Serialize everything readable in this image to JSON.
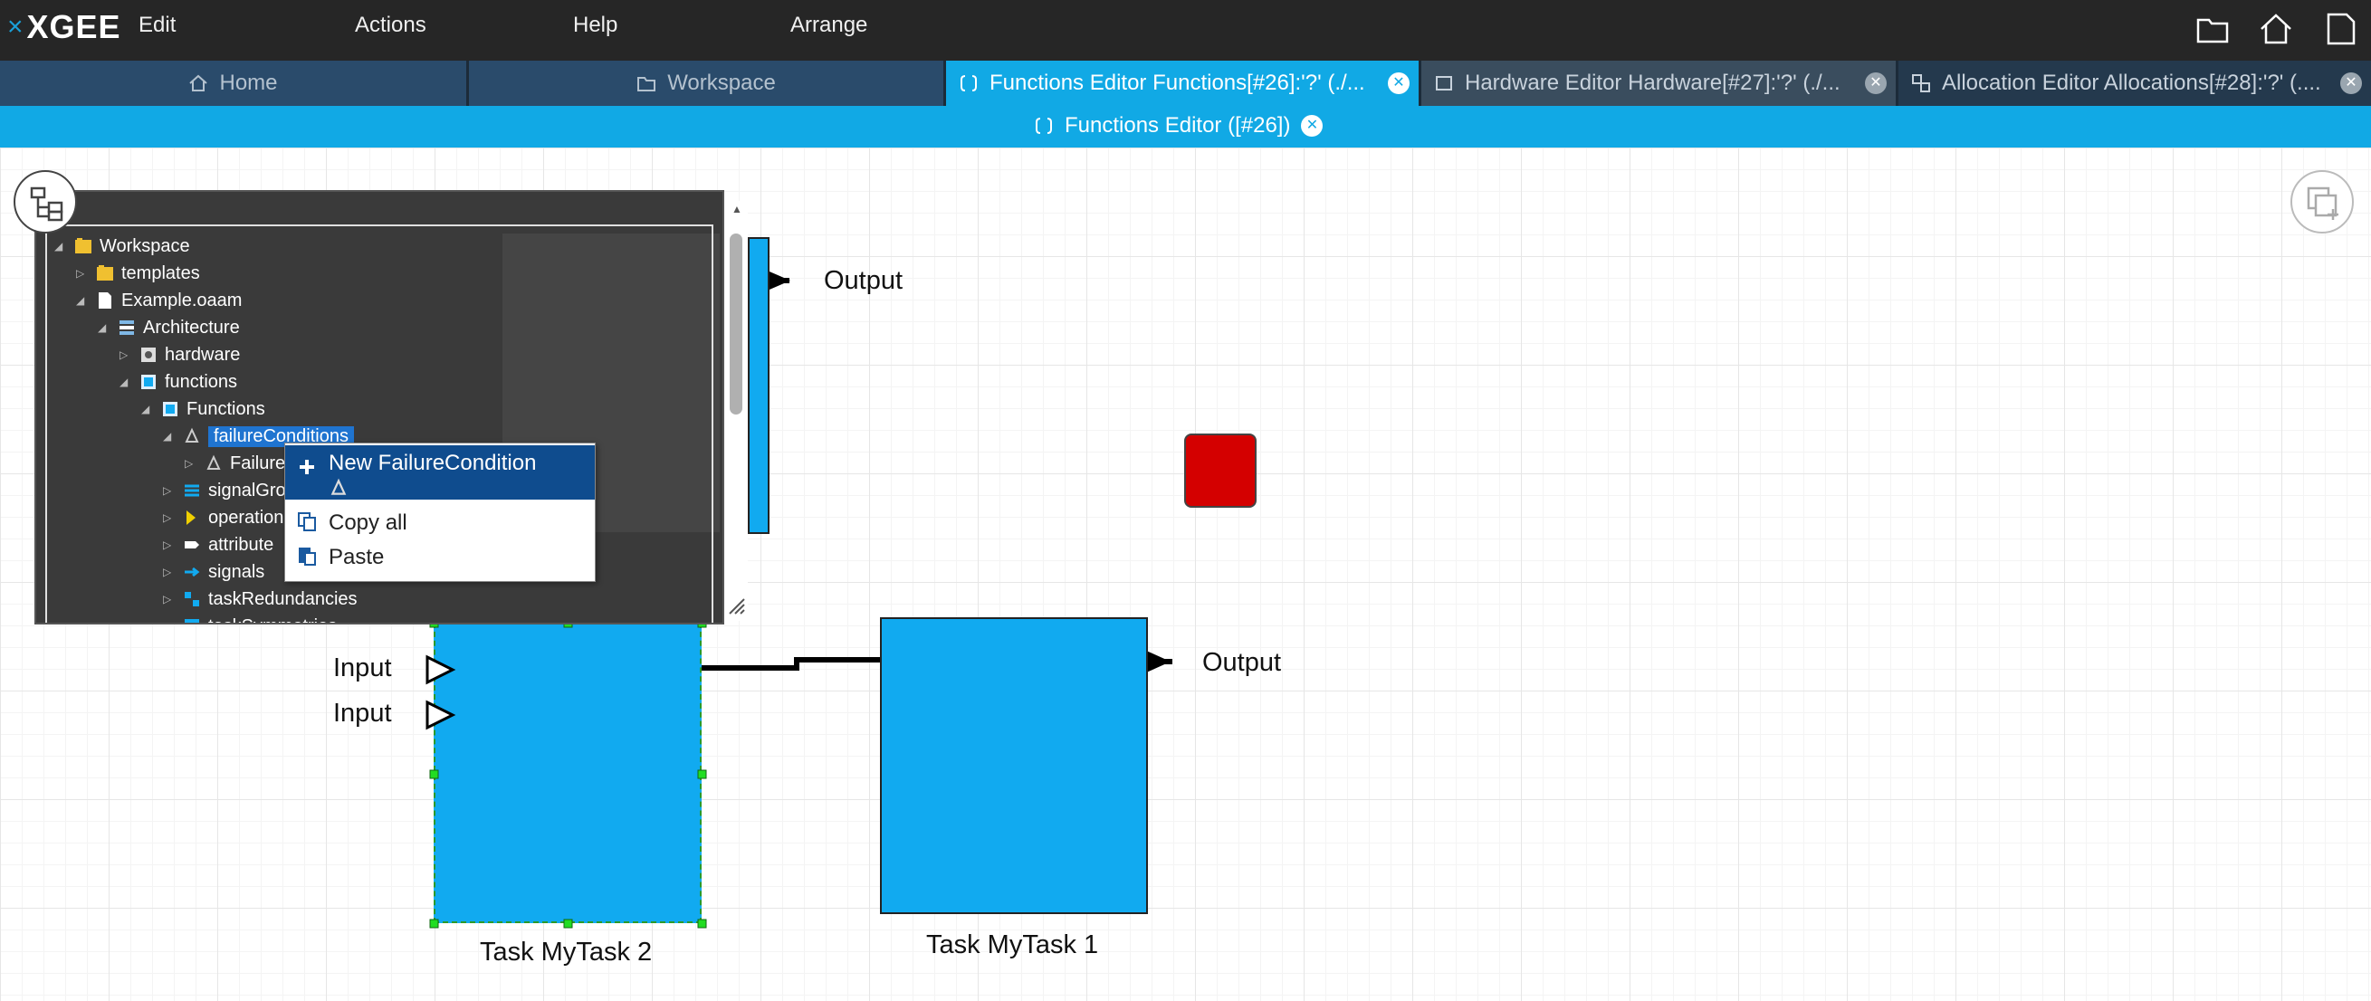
{
  "app": {
    "logo": "XGEE"
  },
  "menu": {
    "edit": "Edit",
    "actions": "Actions",
    "help": "Help",
    "arrange": "Arrange"
  },
  "tabs": [
    {
      "label": "Home",
      "icon": "home-icon",
      "active": false
    },
    {
      "label": "Workspace",
      "icon": "folder-icon",
      "active": false
    },
    {
      "label": "Functions Editor Functions[#26]:'?' (./...",
      "icon": "functions-editor-icon",
      "active": true
    },
    {
      "label": "Hardware Editor Hardware[#27]:'?' (./...",
      "icon": "hardware-editor-icon",
      "active": false
    },
    {
      "label": "Allocation Editor Allocations[#28]:'?' (....",
      "icon": "allocation-editor-icon",
      "active": false
    }
  ],
  "subheader": {
    "title": "Functions Editor ([#26])"
  },
  "tree": {
    "nodes": [
      {
        "label": "Workspace",
        "icon": "workspace-folder-icon"
      },
      {
        "label": "templates",
        "icon": "folder-icon"
      },
      {
        "label": "Example.oaam",
        "icon": "file-icon"
      },
      {
        "label": "Architecture",
        "icon": "architecture-icon"
      },
      {
        "label": "hardware",
        "icon": "hardware-icon"
      },
      {
        "label": "functions",
        "icon": "functions-icon"
      },
      {
        "label": "Functions",
        "icon": "functions-icon"
      },
      {
        "label": "failureConditions",
        "icon": "failure-conditions-icon"
      },
      {
        "label": "Failure",
        "icon": "failure-condition-icon"
      },
      {
        "label": "signalGro",
        "icon": "signal-groups-icon"
      },
      {
        "label": "operation",
        "icon": "operations-icon"
      },
      {
        "label": "attribute",
        "icon": "attributes-icon"
      },
      {
        "label": "signals",
        "icon": "signals-icon"
      },
      {
        "label": "taskRedundancies",
        "icon": "task-redundancies-icon"
      },
      {
        "label": "taskSymmetries",
        "icon": "task-symmetries-icon"
      }
    ]
  },
  "context_menu": {
    "items": [
      {
        "label": "New FailureCondition",
        "icon": "plus-icon"
      },
      {
        "label": "Copy all",
        "icon": "copy-icon"
      },
      {
        "label": "Paste",
        "icon": "paste-icon"
      }
    ]
  },
  "diagram": {
    "task1": {
      "label": "Task MyTask 1",
      "output": "Output"
    },
    "task2": {
      "label": "Task MyTask 2",
      "input1": "Input",
      "input2": "Input"
    },
    "top_output": "Output",
    "colors": {
      "task_fill": "#11aaf0",
      "failure_block": "#d40000",
      "accent": "#11a9e5"
    }
  }
}
